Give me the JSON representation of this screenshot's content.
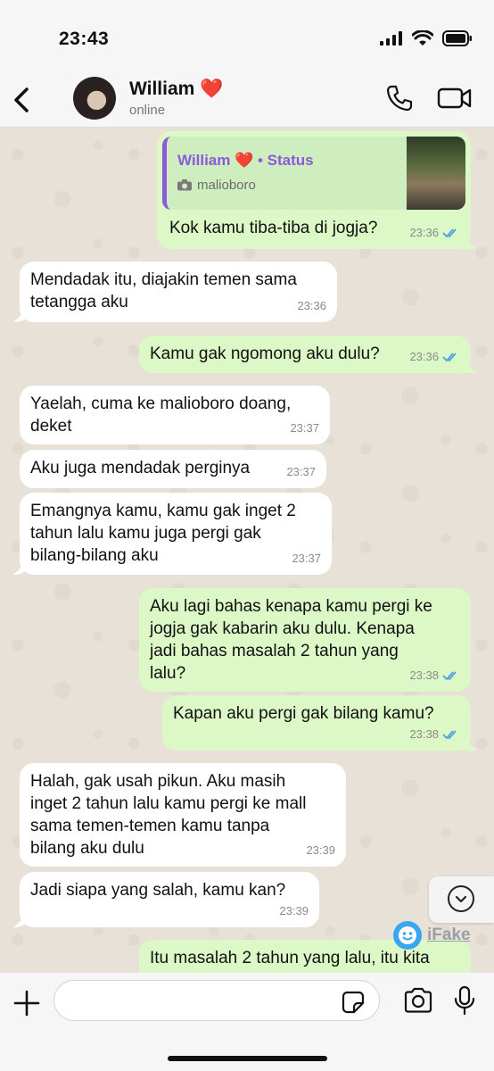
{
  "status_bar": {
    "time": "23:43"
  },
  "header": {
    "contact_name": "William ❤️",
    "contact_status": "online"
  },
  "messages": [
    {
      "dir": "out",
      "text": "Kok kamu tiba-tiba di jogja?",
      "time": "23:36",
      "read": true,
      "reply": {
        "author": "William ❤️ • Status",
        "caption": "malioboro"
      }
    },
    {
      "dir": "in",
      "text": "Mendadak itu, diajakin temen sama\ntetangga aku",
      "time": "23:36"
    },
    {
      "dir": "out",
      "text": "Kamu gak ngomong aku dulu?",
      "time": "23:36",
      "read": true
    },
    {
      "dir": "in",
      "text": "Yaelah, cuma ke malioboro doang,\ndeket",
      "time": "23:37"
    },
    {
      "dir": "in",
      "text": "Aku juga mendadak perginya",
      "time": "23:37"
    },
    {
      "dir": "in",
      "text": "Emangnya kamu, kamu gak inget 2\ntahun lalu kamu juga pergi gak\nbilang-bilang aku",
      "time": "23:37"
    },
    {
      "dir": "out",
      "text": "Aku lagi bahas kenapa kamu pergi ke\njogja gak kabarin aku dulu. Kenapa\njadi bahas masalah 2 tahun yang\nlalu?",
      "time": "23:38",
      "read": true
    },
    {
      "dir": "out",
      "text": "Kapan aku pergi gak bilang kamu?",
      "time": "23:38",
      "read": true
    },
    {
      "dir": "in",
      "text": "Halah, gak usah pikun. Aku masih\ninget 2 tahun lalu kamu pergi ke mall\nsama temen-temen kamu tanpa\nbilang aku dulu",
      "time": "23:39"
    },
    {
      "dir": "in",
      "text": "Jadi siapa yang salah, kamu kan?",
      "time": "23:39"
    },
    {
      "dir": "out",
      "text": "Itu masalah 2 tahun yang lalu, itu kita",
      "time": ""
    }
  ],
  "watermark": {
    "text": "iFake"
  },
  "input": {
    "placeholder": ""
  },
  "colors": {
    "incoming": "#ffffff",
    "outgoing": "#dcf8c6",
    "read_ticks": "#4fa3e0",
    "quote_accent": "#8a5bd8"
  },
  "icons": [
    "back-icon",
    "phone-icon",
    "video-camera-icon",
    "camera-icon",
    "chevron-down-icon",
    "plus-icon",
    "sticker-icon",
    "microphone-icon",
    "double-check-icon"
  ]
}
